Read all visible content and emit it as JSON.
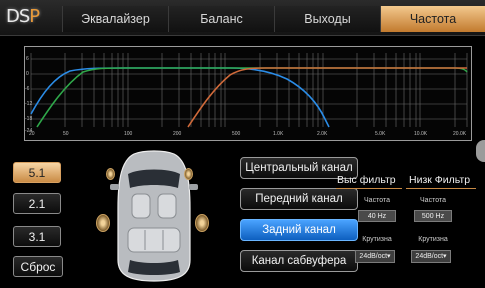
{
  "app": {
    "logo_main": "DS",
    "logo_accent": "P"
  },
  "tabs": [
    {
      "label": "Эквалайзер",
      "active": false
    },
    {
      "label": "Баланс",
      "active": false
    },
    {
      "label": "Выходы",
      "active": false
    },
    {
      "label": "Частота",
      "active": true
    }
  ],
  "graph": {
    "y_ticks": [
      "6",
      "0",
      "-6",
      "-12",
      "-18",
      "-24"
    ],
    "x_ticks": [
      "20",
      "50",
      "100",
      "200",
      "500",
      "1.0K",
      "2.0K",
      "5.0K",
      "10.0K",
      "20.0K"
    ],
    "colors": {
      "blue": "#2b8ce6",
      "green": "#2fa84a",
      "orange": "#d06a3a",
      "grid": "#6e6e6e"
    }
  },
  "presets": {
    "p51": "5.1",
    "p21": "2.1",
    "p31": "3.1",
    "reset": "Сброс",
    "selected": "5.1"
  },
  "channels": {
    "center": "Центральный канал",
    "front": "Передний канал",
    "rear": "Задний канал",
    "sub": "Канал сабвуфера",
    "selected": "Задний канал"
  },
  "hpf": {
    "title": "Выс фильтр",
    "freq_label": "Частота",
    "freq_value": "40 Hz",
    "slope_label": "Крутизна",
    "slope_value": "24dB/oct▾"
  },
  "lpf": {
    "title": "Низк Фильтр",
    "freq_label": "Частота",
    "freq_value": "500 Hz",
    "slope_label": "Крутизна",
    "slope_value": "24dB/oct▾"
  }
}
